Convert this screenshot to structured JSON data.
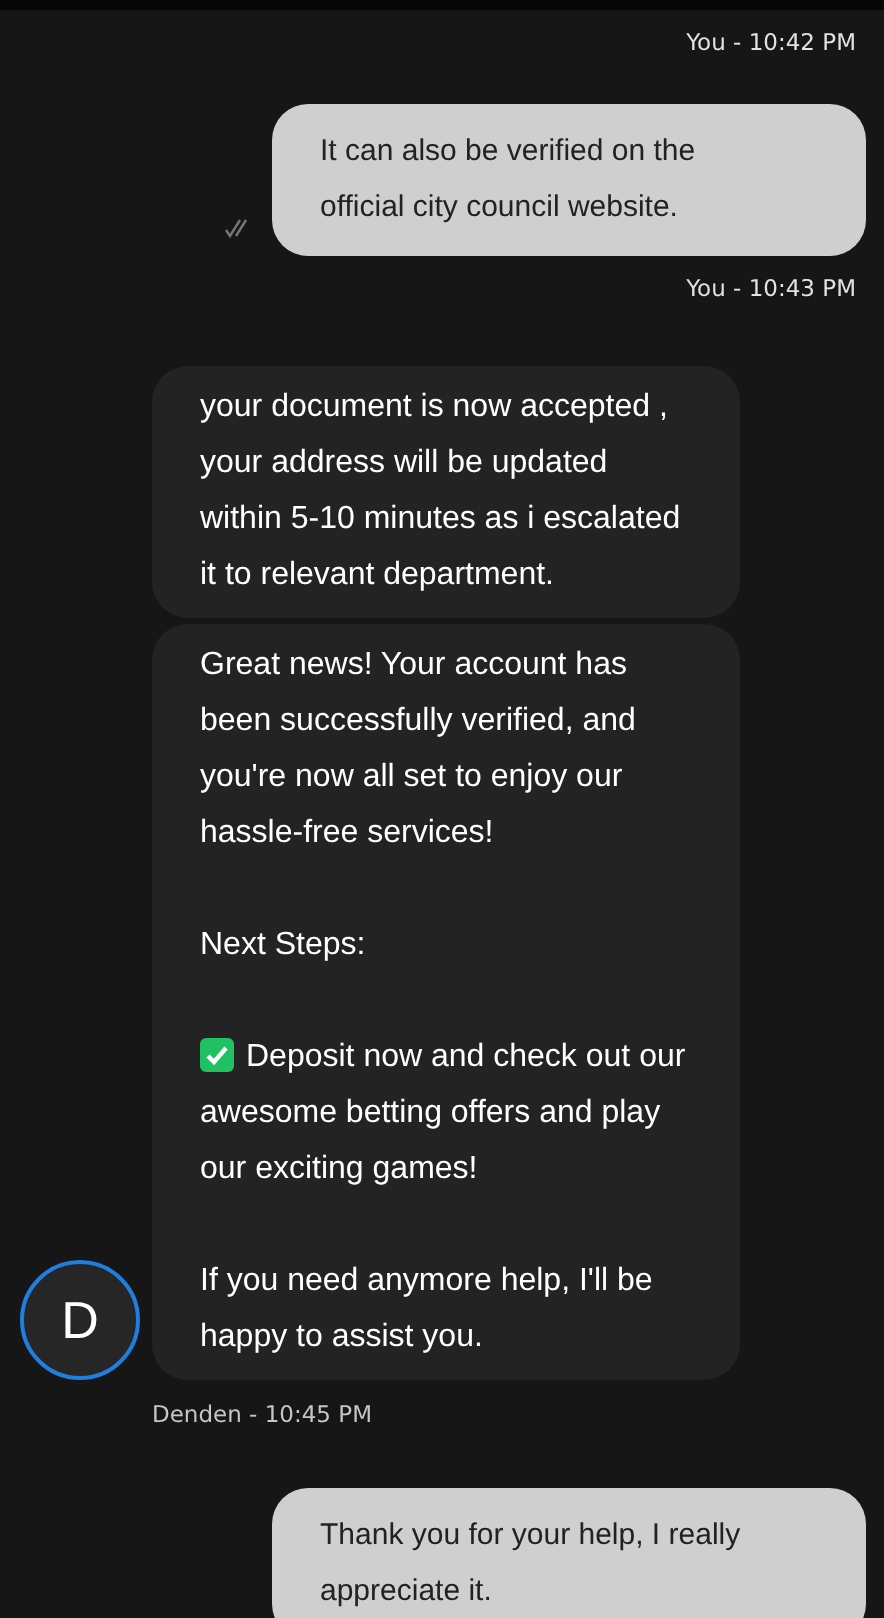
{
  "messages": [
    {
      "kind": "meta",
      "outgoing": true,
      "text": "You - 10:42 PM"
    },
    {
      "kind": "bubble",
      "outgoing": true,
      "read": true,
      "paragraphs": [
        {
          "kind": "text",
          "text": "It can also be verified on the official city council website."
        }
      ]
    },
    {
      "kind": "meta",
      "outgoing": true,
      "text": "You - 10:43 PM"
    },
    {
      "kind": "bubble",
      "outgoing": false,
      "paragraphs": [
        {
          "kind": "text",
          "text": "your document is now accepted , your address will be updated within 5-10 minutes as i escalated it to relevant department."
        }
      ]
    },
    {
      "kind": "bubble",
      "outgoing": false,
      "avatar": "D",
      "paragraphs": [
        {
          "kind": "text",
          "text": "Great news! Your account has been successfully verified, and you're now all set to enjoy our hassle-free services!"
        },
        {
          "kind": "text",
          "text": "Next Steps:"
        },
        {
          "kind": "check",
          "text": "Deposit now and check out our awesome betting offers and play our exciting games!"
        },
        {
          "kind": "text",
          "text": "If you need anymore help, I'll be happy to assist you."
        }
      ]
    },
    {
      "kind": "meta",
      "outgoing": false,
      "text": "Denden - 10:45 PM"
    },
    {
      "kind": "bubble",
      "outgoing": true,
      "paragraphs": [
        {
          "kind": "text",
          "text": "Thank you for your help, I really appreciate it."
        }
      ]
    }
  ]
}
